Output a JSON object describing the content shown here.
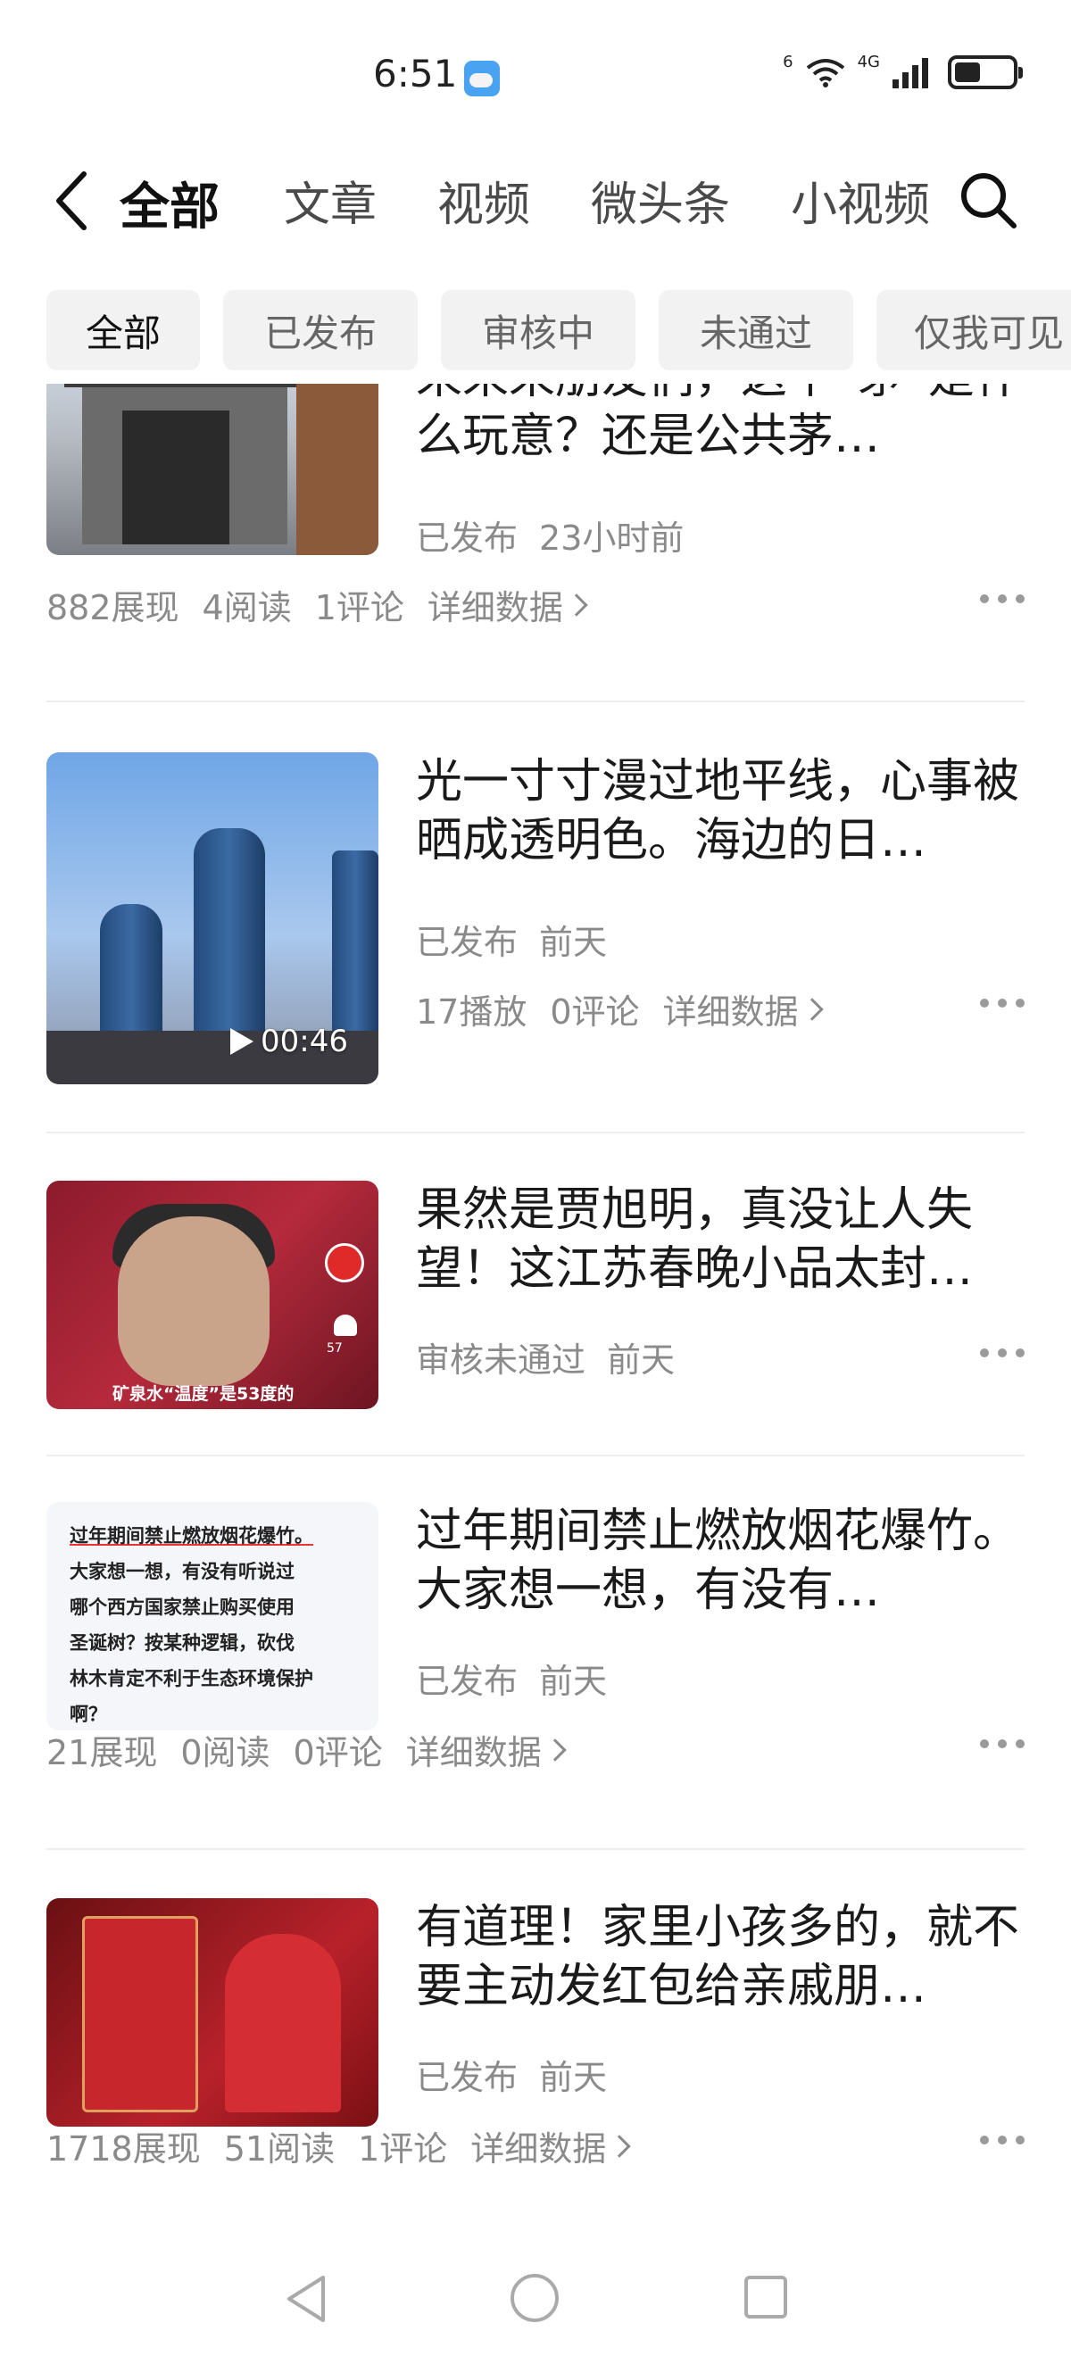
{
  "status_bar": {
    "time": "6:51",
    "weather_icon": "weather-cloud-icon",
    "network_small": "6",
    "network_type": "4G",
    "battery_level": 0.45
  },
  "top_nav": {
    "tabs": [
      {
        "label": "全部",
        "active": true
      },
      {
        "label": "文章",
        "active": false
      },
      {
        "label": "视频",
        "active": false
      },
      {
        "label": "微头条",
        "active": false
      },
      {
        "label": "小视频",
        "active": false
      }
    ]
  },
  "filter_chips": [
    {
      "label": "全部",
      "active": true
    },
    {
      "label": "已发布",
      "active": false
    },
    {
      "label": "审核中",
      "active": false
    },
    {
      "label": "未通过",
      "active": false
    },
    {
      "label": "仅我可见",
      "active": false
    }
  ],
  "feed": {
    "items": [
      {
        "title": "来来来朋友们，这个“茅”是什么玩意？还是公共茅…",
        "status": "已发布",
        "time": "23小时前",
        "stats": [
          "882展现",
          "4阅读",
          "1评论"
        ],
        "detail_label": "详细数据"
      },
      {
        "title": "光一寸寸漫过地平线，心事被晒成透明色。海边的日…",
        "status": "已发布",
        "time": "前天",
        "duration": "00:46",
        "stats": [
          "17播放",
          "0评论"
        ],
        "detail_label": "详细数据"
      },
      {
        "title": "果然是贾旭明，真没让人失望！这江苏春晚小品太封…",
        "status": "审核未通过",
        "time": "前天",
        "thumb_caption": "矿泉水“温度”是53度的",
        "like_count": "57"
      },
      {
        "title": "过年期间禁止燃放烟花爆竹。大家想一想，有没有…",
        "status": "已发布",
        "time": "前天",
        "thumb_text": [
          "过年期间禁止燃放烟花爆竹。",
          "大家想一想，有没有听说过",
          "哪个西方国家禁止购买使用",
          "圣诞树？按某种逻辑，砍伐",
          "林木肯定不利于生态环境保护",
          "啊？"
        ],
        "stats": [
          "21展现",
          "0阅读",
          "0评论"
        ],
        "detail_label": "详细数据"
      },
      {
        "title": "有道理！家里小孩多的，就不要主动发红包给亲戚朋…",
        "status": "已发布",
        "time": "前天",
        "stats": [
          "1718展现",
          "51阅读",
          "1评论"
        ],
        "detail_label": "详细数据"
      }
    ]
  }
}
